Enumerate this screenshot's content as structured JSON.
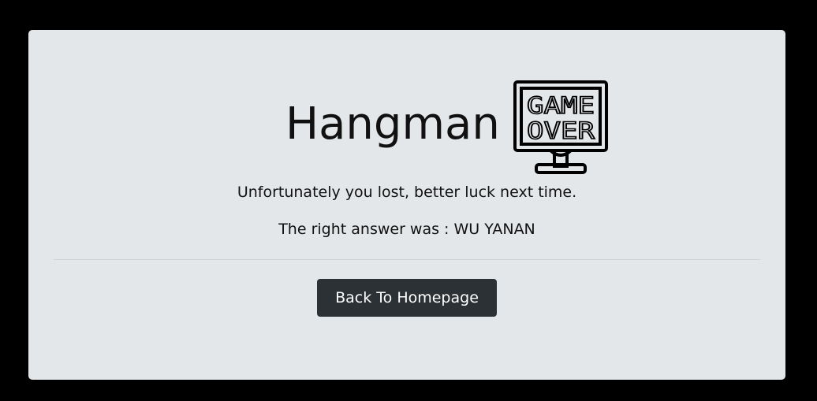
{
  "page": {
    "title": "Hangman",
    "icon": "game-over-monitor-icon",
    "icon_text": [
      "GAME",
      "OVER"
    ],
    "message_lost": "Unfortunately you lost, better luck next time.",
    "message_answer": "The right answer was : WU YANAN",
    "button_label": "Back To Homepage"
  },
  "colors": {
    "background": "#000000",
    "card": "#e4e7ea",
    "button": "#2c3136",
    "button_text": "#ffffff",
    "text": "#111111"
  }
}
